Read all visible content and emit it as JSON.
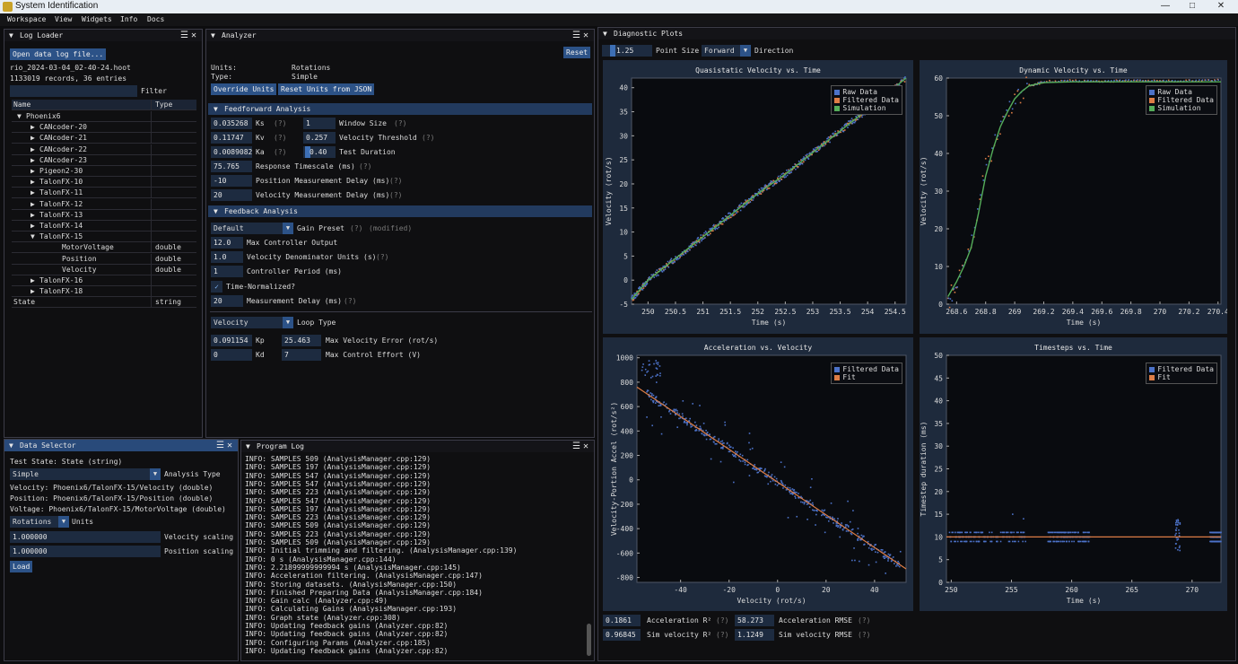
{
  "window": {
    "title": "System Identification"
  },
  "menu": [
    "Workspace",
    "View",
    "Widgets",
    "Info",
    "Docs"
  ],
  "logloader": {
    "title": "Log Loader",
    "open_btn": "Open data log file...",
    "file": "rio_2024-03-04_02-40-24.hoot",
    "records": "1133019 records, 36 entries",
    "filter_label": "Filter",
    "col_name": "Name",
    "col_type": "Type",
    "rows": [
      {
        "name": "Phoenix6",
        "type": "",
        "ind": 0,
        "arrow": "▼"
      },
      {
        "name": "CANcoder-20",
        "type": "",
        "ind": 1,
        "arrow": "▶"
      },
      {
        "name": "CANcoder-21",
        "type": "",
        "ind": 1,
        "arrow": "▶"
      },
      {
        "name": "CANcoder-22",
        "type": "",
        "ind": 1,
        "arrow": "▶"
      },
      {
        "name": "CANcoder-23",
        "type": "",
        "ind": 1,
        "arrow": "▶"
      },
      {
        "name": "Pigeon2-30",
        "type": "",
        "ind": 1,
        "arrow": "▶"
      },
      {
        "name": "TalonFX-10",
        "type": "",
        "ind": 1,
        "arrow": "▶"
      },
      {
        "name": "TalonFX-11",
        "type": "",
        "ind": 1,
        "arrow": "▶"
      },
      {
        "name": "TalonFX-12",
        "type": "",
        "ind": 1,
        "arrow": "▶"
      },
      {
        "name": "TalonFX-13",
        "type": "",
        "ind": 1,
        "arrow": "▶"
      },
      {
        "name": "TalonFX-14",
        "type": "",
        "ind": 1,
        "arrow": "▶"
      },
      {
        "name": "TalonFX-15",
        "type": "",
        "ind": 1,
        "arrow": "▼"
      },
      {
        "name": "MotorVoltage",
        "type": "double",
        "ind": 2,
        "arrow": ""
      },
      {
        "name": "Position",
        "type": "double",
        "ind": 2,
        "arrow": ""
      },
      {
        "name": "Velocity",
        "type": "double",
        "ind": 2,
        "arrow": ""
      },
      {
        "name": "TalonFX-16",
        "type": "",
        "ind": 1,
        "arrow": "▶"
      },
      {
        "name": "TalonFX-18",
        "type": "",
        "ind": 1,
        "arrow": "▶"
      },
      {
        "name": "State",
        "type": "string",
        "ind": -1,
        "arrow": ""
      }
    ]
  },
  "analyzer": {
    "title": "Analyzer",
    "reset": "Reset",
    "units_label": "Units:",
    "units_value": "Rotations",
    "type_label": "Type:",
    "type_value": "Simple",
    "override_btn": "Override Units",
    "reset_units_btn": "Reset Units from JSON",
    "ff_section": "Feedforward Analysis",
    "ks": "0.035268",
    "ks_label": "Ks",
    "kv": "0.11747",
    "kv_label": "Kv",
    "ka": "0.0089082",
    "ka_label": "Ka",
    "window_size": "1",
    "window_size_label": "Window Size",
    "vel_thresh": "0.257",
    "vel_thresh_label": "Velocity Threshold",
    "test_dur": "0.40",
    "test_dur_label": "Test Duration",
    "resp_ts": "75.765",
    "resp_ts_label": "Response Timescale (ms)",
    "pos_delay": "-10",
    "pos_delay_label": "Position Measurement Delay (ms)",
    "vel_delay": "20",
    "vel_delay_label": "Velocity Measurement Delay (ms)",
    "fb_section": "Feedback Analysis",
    "preset": "Default",
    "preset_label": "Gain Preset",
    "preset_mod": "(modified)",
    "max_out": "12.0",
    "max_out_label": "Max Controller Output",
    "vel_denom": "1.0",
    "vel_denom_label": "Velocity Denominator Units (s)",
    "ctrl_period": "1",
    "ctrl_period_label": "Controller Period (ms)",
    "time_norm_label": "Time-Normalized?",
    "meas_delay": "20",
    "meas_delay_label": "Measurement Delay (ms)",
    "loop_type": "Velocity",
    "loop_type_label": "Loop Type",
    "kp": "0.091154",
    "kp_label": "Kp",
    "kd": "0",
    "kd_label": "Kd",
    "max_vel_err": "25.463",
    "max_vel_err_label": "Max Velocity Error (rot/s)",
    "max_ctrl": "7",
    "max_ctrl_label": "Max Control Effort (V)",
    "help": "(?)"
  },
  "dataselector": {
    "title": "Data Selector",
    "test_state": "Test State: State (string)",
    "analysis": "Simple",
    "analysis_label": "Analysis Type",
    "velocity": "Velocity: Phoenix6/TalonFX-15/Velocity (double)",
    "position": "Position: Phoenix6/TalonFX-15/Position (double)",
    "voltage": "Voltage: Phoenix6/TalonFX-15/MotorVoltage (double)",
    "units": "Rotations",
    "units_label": "Units",
    "vel_scale": "1.000000",
    "vel_scale_label": "Velocity scaling",
    "pos_scale": "1.000000",
    "pos_scale_label": "Position scaling",
    "load": "Load"
  },
  "programlog": {
    "title": "Program Log",
    "lines": [
      "INFO: SAMPLES 509 (AnalysisManager.cpp:129)",
      "INFO: SAMPLES 197 (AnalysisManager.cpp:129)",
      "INFO: SAMPLES 547 (AnalysisManager.cpp:129)",
      "INFO: SAMPLES 547 (AnalysisManager.cpp:129)",
      "INFO: SAMPLES 223 (AnalysisManager.cpp:129)",
      "INFO: SAMPLES 547 (AnalysisManager.cpp:129)",
      "INFO: SAMPLES 197 (AnalysisManager.cpp:129)",
      "INFO: SAMPLES 223 (AnalysisManager.cpp:129)",
      "INFO: SAMPLES 509 (AnalysisManager.cpp:129)",
      "INFO: SAMPLES 223 (AnalysisManager.cpp:129)",
      "INFO: SAMPLES 509 (AnalysisManager.cpp:129)",
      "INFO: Initial trimming and filtering. (AnalysisManager.cpp:139)",
      "INFO: 0 s (AnalysisManager.cpp:144)",
      "INFO: 2.21899999999994 s (AnalysisManager.cpp:145)",
      "INFO: Acceleration filtering. (AnalysisManager.cpp:147)",
      "INFO: Storing datasets. (AnalysisManager.cpp:150)",
      "INFO: Finished Preparing Data (AnalysisManager.cpp:184)",
      "INFO: Gain calc (Analyzer.cpp:49)",
      "INFO: Calculating Gains (AnalysisManager.cpp:193)",
      "INFO: Graph state (Analyzer.cpp:308)",
      "INFO: Updating feedback gains (Analyzer.cpp:82)",
      "INFO: Updating feedback gains (Analyzer.cpp:82)",
      "INFO: Configuring Params (Analyzer.cpp:185)",
      "INFO: Updating feedback gains (Analyzer.cpp:82)"
    ]
  },
  "diag": {
    "title": "Diagnostic Plots",
    "point_size": "1.25",
    "point_size_label": "Point Size",
    "direction": "Forward",
    "direction_label": "Direction",
    "acc_r2": "0.1861",
    "acc_r2_label": "Acceleration R²",
    "acc_rmse": "58.273",
    "acc_rmse_label": "Acceleration RMSE",
    "sim_r2": "0.96845",
    "sim_r2_label": "Sim velocity R²",
    "sim_rmse": "1.1249",
    "sim_rmse_label": "Sim velocity RMSE",
    "help": "(?)"
  },
  "colors": {
    "raw": "#4c72c8",
    "filtered": "#dd7d46",
    "sim": "#55ad5a",
    "fit": "#dd7d46"
  },
  "chart_data": [
    {
      "type": "scatter",
      "title": "Quasistatic Velocity vs. Time",
      "xlabel": "Time (s)",
      "ylabel": "Velocity (rot/s)",
      "xlim": [
        249.7,
        254.7
      ],
      "ylim": [
        -5,
        42
      ],
      "xticks": [
        250,
        250.5,
        251,
        251.5,
        252,
        252.5,
        253,
        253.5,
        254,
        254.5
      ],
      "yticks": [
        -5,
        0,
        5,
        10,
        15,
        20,
        25,
        30,
        35,
        40
      ],
      "legend": [
        "Raw Data",
        "Filtered Data",
        "Simulation"
      ],
      "series": [
        {
          "name": "Raw Data",
          "x": [
            249.7,
            250.0,
            250.5,
            251.0,
            251.5,
            252.0,
            252.5,
            253.0,
            253.5,
            254.0,
            254.7
          ],
          "y": [
            -4,
            0,
            4.5,
            9,
            13.5,
            18,
            22,
            26.5,
            31,
            35.5,
            42
          ]
        },
        {
          "name": "Simulation",
          "x": [
            249.7,
            254.7
          ],
          "y": [
            -1,
            42
          ]
        }
      ]
    },
    {
      "type": "line",
      "title": "Dynamic Velocity vs. Time",
      "xlabel": "Time (s)",
      "ylabel": "Velocity (rot/s)",
      "xlim": [
        268.53,
        270.42
      ],
      "ylim": [
        0,
        60
      ],
      "xticks": [
        268.6,
        268.8,
        269,
        269.2,
        269.4,
        269.6,
        269.8,
        270,
        270.2,
        270.4
      ],
      "yticks": [
        0,
        10,
        20,
        30,
        40,
        50,
        60
      ],
      "legend": [
        "Raw Data",
        "Filtered Data",
        "Simulation"
      ],
      "series": [
        {
          "name": "Simulation",
          "x": [
            268.54,
            268.6,
            268.65,
            268.7,
            268.75,
            268.8,
            268.85,
            268.9,
            268.95,
            269.0,
            269.05,
            269.1,
            269.2,
            269.4,
            270.42
          ],
          "y": [
            2,
            6,
            10,
            15,
            24,
            34,
            41,
            47,
            51,
            54.5,
            56.5,
            58,
            58.8,
            59,
            59
          ]
        },
        {
          "name": "Raw Data",
          "x": [
            268.54,
            268.6,
            268.7,
            268.8,
            268.9,
            269.0,
            269.1,
            269.2,
            269.4,
            269.6,
            269.8,
            270.0,
            270.2,
            270.42
          ],
          "y": [
            1,
            5,
            17,
            36,
            48,
            55,
            58,
            59,
            59.3,
            59.1,
            59.4,
            59.2,
            59.3,
            59.4
          ]
        }
      ]
    },
    {
      "type": "scatter",
      "title": "Acceleration vs. Velocity",
      "xlabel": "Velocity (rot/s)",
      "ylabel": "Velocity-Portion Accel (rot/s²)",
      "xlim": [
        -58,
        53
      ],
      "ylim": [
        -840,
        1020
      ],
      "xticks": [
        -40,
        -20,
        0,
        20,
        40
      ],
      "yticks": [
        -800,
        -600,
        -400,
        -200,
        0,
        200,
        400,
        600,
        800,
        1000
      ],
      "legend": [
        "Filtered Data",
        "Fit"
      ],
      "series": [
        {
          "name": "Fit",
          "x": [
            -58,
            53
          ],
          "y": [
            760,
            -730
          ]
        }
      ]
    },
    {
      "type": "scatter",
      "title": "Timesteps vs. Time",
      "xlabel": "Time (s)",
      "ylabel": "Timestep duration (ms)",
      "xlim": [
        249.6,
        272.4
      ],
      "ylim": [
        0,
        50
      ],
      "xticks": [
        250,
        255,
        260,
        265,
        270
      ],
      "yticks": [
        0,
        5,
        10,
        15,
        20,
        25,
        30,
        35,
        40,
        45,
        50
      ],
      "legend": [
        "Filtered Data",
        "Fit"
      ],
      "series": [
        {
          "name": "Fit",
          "x": [
            249.6,
            272.4
          ],
          "y": [
            10,
            10
          ]
        }
      ]
    }
  ]
}
